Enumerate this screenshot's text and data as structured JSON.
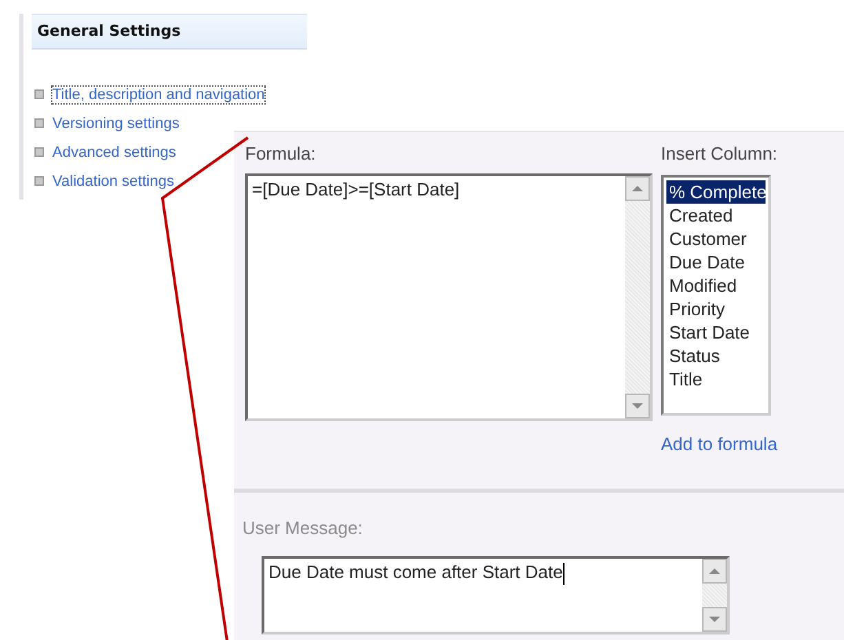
{
  "settings": {
    "heading": "General Settings",
    "links": [
      {
        "label": "Title, description and navigation",
        "focused": true
      },
      {
        "label": "Versioning settings",
        "focused": false
      },
      {
        "label": "Advanced settings",
        "focused": false
      },
      {
        "label": "Validation settings",
        "focused": false
      }
    ]
  },
  "formula_panel": {
    "formula_label": "Formula:",
    "formula": "=[Due Date]>=[Start Date]",
    "insert_column_label": "Insert Column:",
    "columns": [
      {
        "label": "% Complete",
        "selected": true
      },
      {
        "label": "Created",
        "selected": false
      },
      {
        "label": "Customer",
        "selected": false
      },
      {
        "label": "Due Date",
        "selected": false
      },
      {
        "label": "Modified",
        "selected": false
      },
      {
        "label": "Priority",
        "selected": false
      },
      {
        "label": "Start Date",
        "selected": false
      },
      {
        "label": "Status",
        "selected": false
      },
      {
        "label": "Title",
        "selected": false
      }
    ],
    "add_link": "Add to formula",
    "message_label": "User Message:",
    "message": "Due Date must come after Start Date"
  }
}
